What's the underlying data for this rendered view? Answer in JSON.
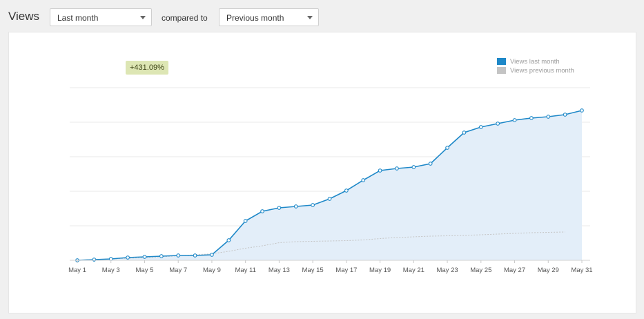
{
  "header": {
    "title": "Views",
    "period_select": "Last month",
    "compared_label": "compared to",
    "compare_select": "Previous month"
  },
  "badge": "+431.09%",
  "colors": {
    "current": "#1e88c8",
    "current_fill": "#e3eef9",
    "previous": "#c4c4c4",
    "previous_fill": "#eaeaea",
    "badge_bg": "#dde6b4",
    "grid": "#e8e8e8"
  },
  "chart_data": {
    "type": "area",
    "ylim": [
      0,
      100
    ],
    "grid": true,
    "legend_position": "top-right",
    "x": [
      "May 1",
      "May 2",
      "May 3",
      "May 4",
      "May 5",
      "May 6",
      "May 7",
      "May 8",
      "May 9",
      "May 10",
      "May 11",
      "May 12",
      "May 13",
      "May 14",
      "May 15",
      "May 16",
      "May 17",
      "May 18",
      "May 19",
      "May 20",
      "May 21",
      "May 22",
      "May 23",
      "May 24",
      "May 25",
      "May 26",
      "May 27",
      "May 28",
      "May 29",
      "May 30",
      "May 31"
    ],
    "xtick_labels": [
      "May 1",
      "May 3",
      "May 5",
      "May 7",
      "May 9",
      "May 11",
      "May 13",
      "May 15",
      "May 17",
      "May 19",
      "May 21",
      "May 23",
      "May 25",
      "May 27",
      "May 29",
      "May 31"
    ],
    "series": [
      {
        "name": "Views last month",
        "values": [
          0,
          0.4,
          0.8,
          1.6,
          2.0,
          2.4,
          2.8,
          2.8,
          3.2,
          11.6,
          22.8,
          28.4,
          30.4,
          31.2,
          32,
          35.6,
          40.4,
          46.4,
          52,
          53.2,
          54,
          56,
          65.2,
          74,
          77.2,
          79.2,
          81.2,
          82.4,
          83.2,
          84.4,
          86.8
        ]
      },
      {
        "name": "Views previous month",
        "values": [
          0,
          0.4,
          0.8,
          1.2,
          1.6,
          2.0,
          2.6,
          3.2,
          3.8,
          5.2,
          7.0,
          8.4,
          10.2,
          10.8,
          11.0,
          11.2,
          11.4,
          11.8,
          12.6,
          13.2,
          13.6,
          14.0,
          14.2,
          14.4,
          14.8,
          15.2,
          15.6,
          16.0,
          16.2,
          16.4,
          16.6
        ]
      }
    ]
  }
}
